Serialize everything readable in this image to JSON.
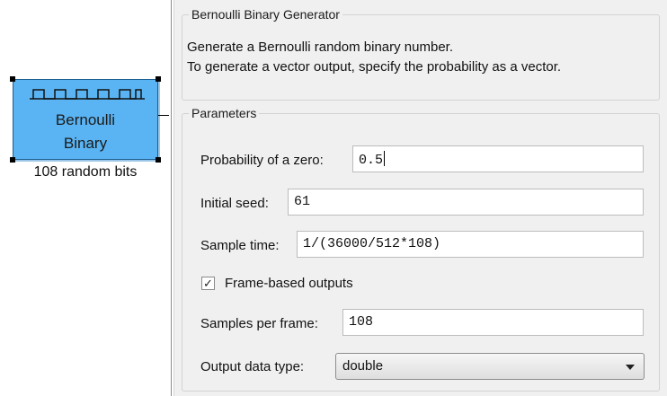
{
  "block": {
    "line1": "Bernoulli",
    "line2": "Binary",
    "caption": "108 random bits",
    "color": "#5ab4f3"
  },
  "dialog": {
    "title": "Bernoulli Binary Generator",
    "description_line1": "Generate a Bernoulli random binary number.",
    "description_line2": "To generate a vector output, specify the probability as a vector.",
    "parameters_title": "Parameters",
    "fields": {
      "prob_zero": {
        "label": "Probability of a zero:",
        "value": "0.5"
      },
      "initial_seed": {
        "label": "Initial seed:",
        "value": "61"
      },
      "sample_time": {
        "label": "Sample time:",
        "value": "1/(36000/512*108)"
      },
      "frame_based": {
        "label": "Frame-based outputs",
        "checked": true,
        "mark": "✓"
      },
      "samples_per_frame": {
        "label": "Samples per frame:",
        "value": "108"
      },
      "output_data_type": {
        "label": "Output data type:",
        "value": "double"
      }
    }
  },
  "icons": {
    "block_wave": "square-wave-icon",
    "dropdown": "chevron-down-icon",
    "checkbox": "check-icon"
  }
}
